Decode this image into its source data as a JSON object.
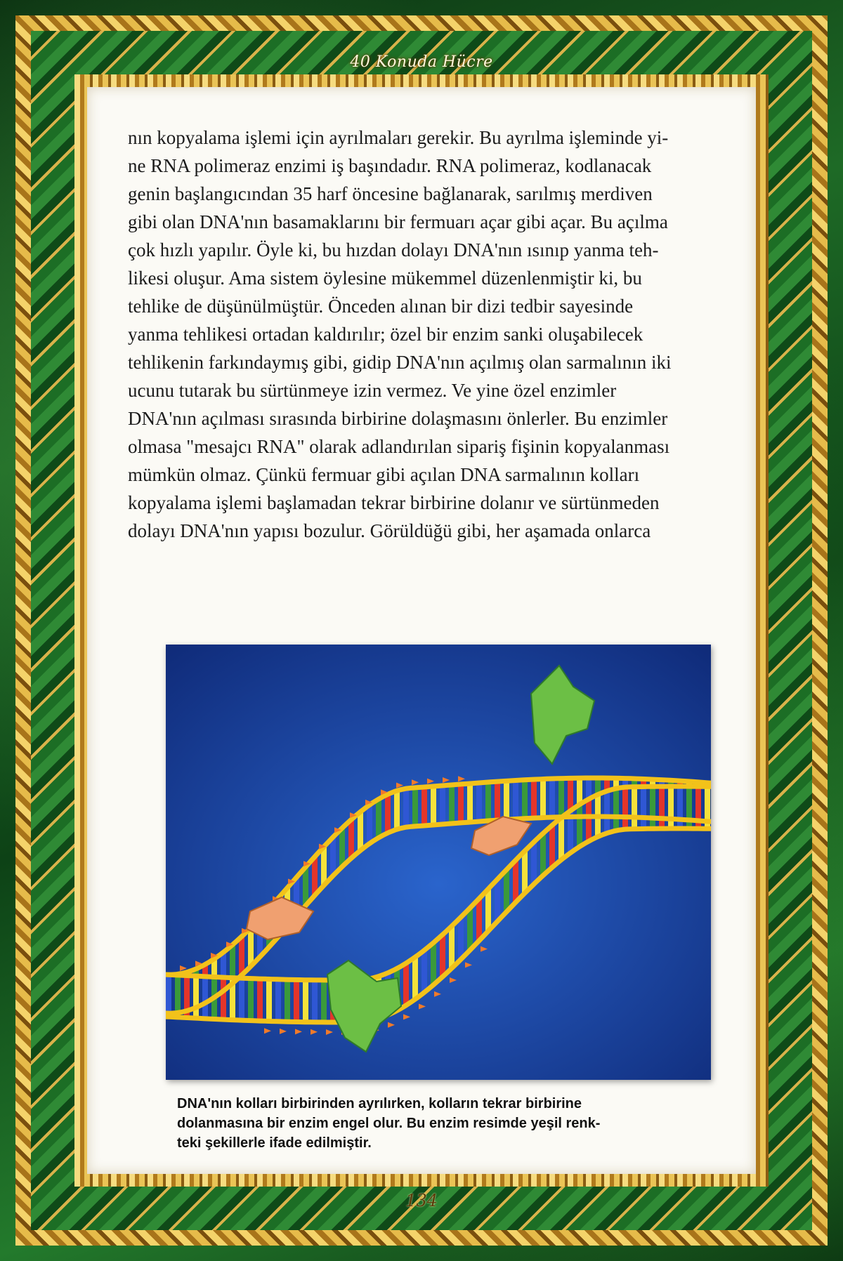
{
  "header": {
    "running_title": "40 Konuda Hücre"
  },
  "body": {
    "paragraph": "nın kopyalama işlemi için ayrılmaları gerekir. Bu ayrılma işleminde yi-\nne RNA polimeraz enzimi iş başındadır. RNA polimeraz, kodlanacak\ngenin başlangıcından 35 harf öncesine bağlanarak, sarılmış merdiven\ngibi olan DNA'nın basamaklarını bir fermuarı açar gibi açar. Bu açılma\nçok hızlı yapılır. Öyle ki, bu hızdan dolayı DNA'nın ısınıp yanma teh-\nlikesi oluşur. Ama sistem öylesine mükemmel düzenlenmiştir ki, bu\ntehlike de düşünülmüştür. Önceden alınan bir dizi tedbir sayesinde\nyanma tehlikesi ortadan kaldırılır; özel bir enzim sanki oluşabilecek\ntehlikenin farkındaymış gibi, gidip DNA'nın açılmış olan sarmalının iki\nucunu tutarak bu sürtünmeye izin vermez. Ve yine özel enzimler\nDNA'nın açılması sırasında birbirine dolaşmasını önlerler. Bu enzimler\nolmasa \"mesajcı RNA\" olarak adlandırılan sipariş fişinin kopyalanması\nmümkün olmaz. Çünkü fermuar gibi açılan DNA sarmalının kolları\nkopyalama işlemi başlamadan tekrar birbirine dolanır ve sürtünmeden\ndolayı DNA'nın yapısı bozulur. Görüldüğü gibi, her aşamada onlarca"
  },
  "figure": {
    "caption": "DNA'nın kolları birbirinden ayrılırken, kolların tekrar birbirine\ndolanmasına bir enzim engel olur. Bu enzim resimde yeşil renk-\nteki şekillerle ifade edilmiştir.",
    "background_color": "#1f4fb0",
    "strand_color": "#f2c21a",
    "base_colors": [
      "#e4352a",
      "#f5e23a",
      "#2f57d4",
      "#3a9a3a"
    ],
    "enzyme_color": "#6cbf45",
    "polymerase_color": "#f0a070"
  },
  "footer": {
    "page_number": "134"
  }
}
